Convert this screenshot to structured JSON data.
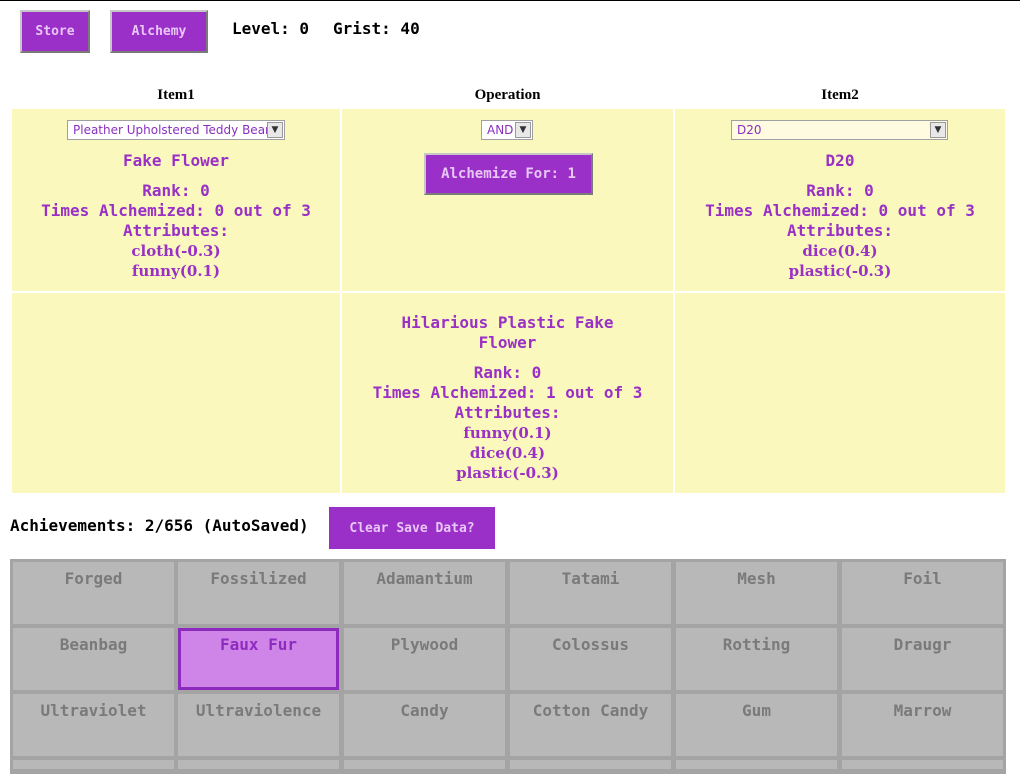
{
  "toolbar": {
    "store_label": "Store",
    "alchemy_label": "Alchemy",
    "level_text": "Level: 0",
    "grist_text": "Grist: 40"
  },
  "columns": {
    "item1": "Item1",
    "operation": "Operation",
    "item2": "Item2"
  },
  "item1": {
    "select_value": "Pleather Upholstered Teddy Bear",
    "name": "Fake Flower",
    "rank": "Rank: 0",
    "times": "Times Alchemized: 0 out of 3",
    "attributes_label": "Attributes:",
    "attributes": [
      "cloth(-0.3)",
      "funny(0.1)"
    ]
  },
  "operation": {
    "select_value": "AND",
    "alchemize_label": "Alchemize For: 1"
  },
  "item2": {
    "select_value": "D20",
    "name": "D20",
    "rank": "Rank: 0",
    "times": "Times Alchemized: 0 out of 3",
    "attributes_label": "Attributes:",
    "attributes": [
      "dice(0.4)",
      "plastic(-0.3)"
    ]
  },
  "result": {
    "name_line1": "Hilarious Plastic Fake",
    "name_line2": "Flower",
    "rank": "Rank: 0",
    "times": "Times Alchemized: 1 out of 3",
    "attributes_label": "Attributes:",
    "attributes": [
      "funny(0.1)",
      "dice(0.4)",
      "plastic(-0.3)"
    ]
  },
  "achievements": {
    "text": "Achievements: 2/656 (AutoSaved)",
    "clear_label": "Clear Save Data?"
  },
  "grid": [
    [
      "Forged",
      "Fossilized",
      "Adamantium",
      "Tatami",
      "Mesh",
      "Foil"
    ],
    [
      "Beanbag",
      "Faux Fur",
      "Plywood",
      "Colossus",
      "Rotting",
      "Draugr"
    ],
    [
      "Ultraviolet",
      "Ultraviolence",
      "Candy",
      "Cotton Candy",
      "Gum",
      "Marrow"
    ]
  ],
  "colors": {
    "accent": "#9b30c9",
    "panel": "#fbf8bd",
    "tile": "#b8b8b8",
    "tile_active": "#cf84e8"
  }
}
